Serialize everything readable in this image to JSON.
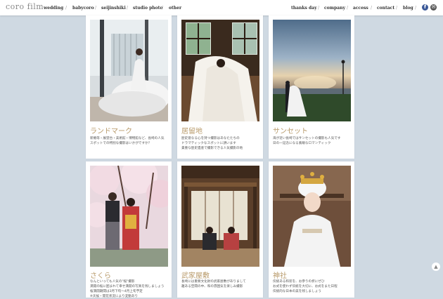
{
  "header": {
    "logo": "coro film",
    "nav_left": [
      "wedding",
      "babycoro",
      "seijinshiki",
      "studio photo",
      "other"
    ],
    "nav_right": [
      "thanks day",
      "company",
      "access",
      "contact",
      "blog"
    ],
    "separator": "/",
    "social": {
      "facebook": "f",
      "mail": "✉"
    }
  },
  "cards": [
    {
      "title": "ランドマーク",
      "desc": [
        "新婚等・展望台・美術館・博物館など、長崎の人気",
        "スポットでの特別な撮影はいかがですか？"
      ]
    },
    {
      "title": "居留地",
      "desc": [
        "歴史意なる心を持つ撮影はあなたたちの",
        "ドラマティックなスポットに誘います",
        "貴重な歴史遺産で撮影できる人気撮影の地"
      ]
    },
    {
      "title": "サンセット",
      "desc": [
        "海が近い長崎ではサンセットの撮影も人気です",
        "日の一記念になる素敵なロマンティック"
      ]
    },
    {
      "title": "さくら",
      "desc": [
        "なんといっても人気の\"桜\"撮影",
        "満開の桜に囲まれて幸せ満開の写真を残しましょう",
        "桜満開期間は3月下旬〜4月上旬予定",
        "※天候・開花状況により変動あり"
      ]
    },
    {
      "title": "武家屋敷",
      "desc": [
        "長崎には重要文化財の武家屋敷がありまして",
        "趣ある空間の中、和の雰囲気を楽しみ撮影"
      ]
    },
    {
      "title": "神社",
      "desc": [
        "伝統ある和装を、お参りの折にぜひ",
        "お式を使わず伝統を大切に、お式をまた日程",
        "伝統的な日本の美を残しましょう"
      ]
    }
  ],
  "scroll_top": "▲"
}
